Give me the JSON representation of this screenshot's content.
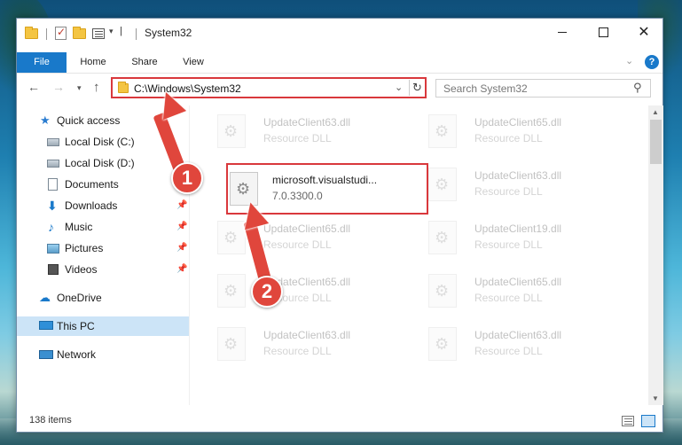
{
  "window": {
    "title": "System32"
  },
  "ribbon": {
    "tabs": [
      "File",
      "Home",
      "Share",
      "View"
    ]
  },
  "navigation": {
    "address": "C:\\Windows\\System32",
    "search_placeholder": "Search System32"
  },
  "sidebar": {
    "items": [
      {
        "label": "Quick access",
        "icon": "star-icon"
      },
      {
        "label": "Local Disk (C:)",
        "icon": "disk-icon"
      },
      {
        "label": "Local Disk (D:)",
        "icon": "disk-icon"
      },
      {
        "label": "Documents",
        "icon": "documents-icon",
        "pinned": true
      },
      {
        "label": "Downloads",
        "icon": "download-icon",
        "pinned": true
      },
      {
        "label": "Music",
        "icon": "music-icon",
        "pinned": true
      },
      {
        "label": "Pictures",
        "icon": "pictures-icon",
        "pinned": true
      },
      {
        "label": "Videos",
        "icon": "videos-icon",
        "pinned": true
      },
      {
        "label": "OneDrive",
        "icon": "cloud-icon"
      },
      {
        "label": "This PC",
        "icon": "computer-icon",
        "selected": true
      },
      {
        "label": "Network",
        "icon": "network-icon"
      }
    ]
  },
  "files": {
    "highlighted": {
      "name": "microsoft.visualstudi...",
      "detail": "7.0.3300.0"
    },
    "items": [
      {
        "name": "UpdateClient63.dll",
        "detail": "Resource DLL"
      },
      {
        "name": "UpdateClient65.dll",
        "detail": "Resource DLL"
      },
      {
        "name": "UpdateClient63.dll",
        "detail": "Resource DLL"
      },
      {
        "name": "UpdateClient65.dll",
        "detail": "Resource DLL"
      },
      {
        "name": "UpdateClient19.dll",
        "detail": "Resource DLL"
      },
      {
        "name": "UpdateClient65.dll",
        "detail": "Resource DLL"
      },
      {
        "name": "UpdateClient65.dll",
        "detail": "Resource DLL"
      },
      {
        "name": "UpdateClient63.dll",
        "detail": "Resource DLL"
      },
      {
        "name": "UpdateClient63.dll",
        "detail": "Resource DLL"
      }
    ]
  },
  "status": {
    "item_count": "138 items"
  },
  "annotations": {
    "badge1": "1",
    "badge2": "2",
    "color": "#e0463c"
  }
}
